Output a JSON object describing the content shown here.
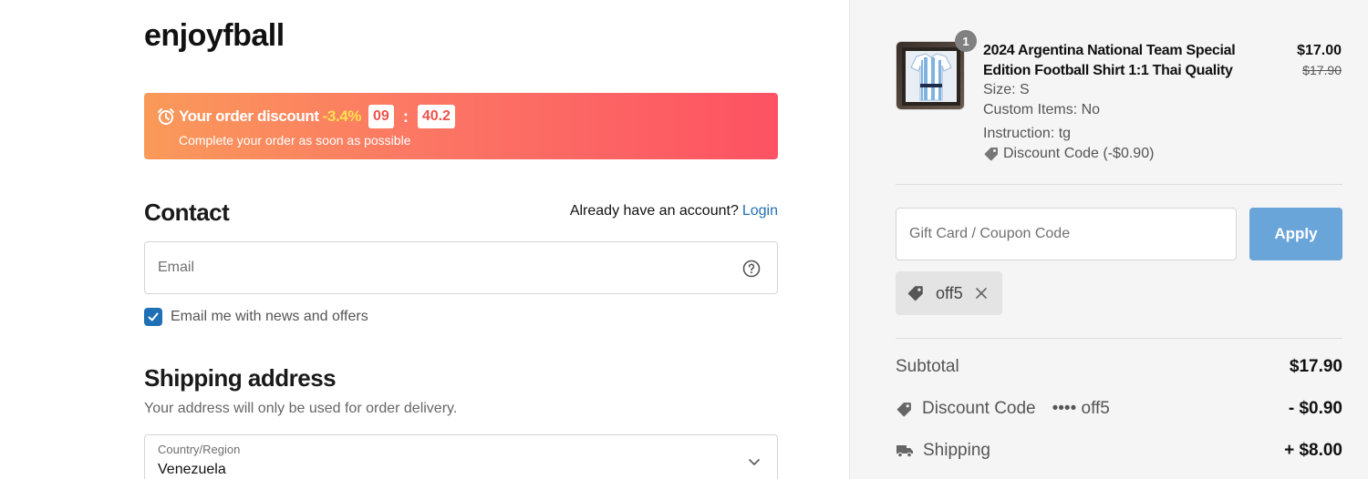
{
  "brand": "enjoyfball",
  "banner": {
    "title": "Your order discount",
    "discount": "-3.4%",
    "minutes": "09",
    "separator": ":",
    "seconds": "40.2",
    "subtitle": "Complete your order as soon as possible",
    "colors": {
      "from": "#fa9a5a",
      "to": "#fd5263",
      "highlight": "#ffe14d"
    }
  },
  "contact": {
    "heading": "Contact",
    "account_prompt": "Already have an account?",
    "login_label": "Login",
    "email_placeholder": "Email",
    "newsletter_label": "Email me with news and offers",
    "newsletter_checked": true
  },
  "shipping": {
    "heading": "Shipping address",
    "subtitle": "Your address will only be used for order delivery.",
    "country_label": "Country/Region",
    "country_value": "Venezuela"
  },
  "cart": {
    "item": {
      "quantity": "1",
      "name": "2024 Argentina National Team Special Edition Football Shirt 1:1 Thai Quality",
      "price": "$17.00",
      "original_price": "$17.90",
      "size": "Size: S",
      "custom": "Custom Items: No",
      "instruction": "Instruction:  tg",
      "discount": "Discount Code (-$0.90)"
    },
    "coupon_placeholder": "Gift Card / Coupon Code",
    "apply_label": "Apply",
    "applied_code": "off5",
    "summary": {
      "subtotal_label": "Subtotal",
      "subtotal_value": "$17.90",
      "discount_label": "Discount Code",
      "discount_code": "•••• off5",
      "discount_value": "- $0.90",
      "shipping_label": "Shipping",
      "shipping_value": "+ $8.00"
    }
  },
  "accent_color": "#1f6fb5",
  "apply_color": "#6aa5d9"
}
